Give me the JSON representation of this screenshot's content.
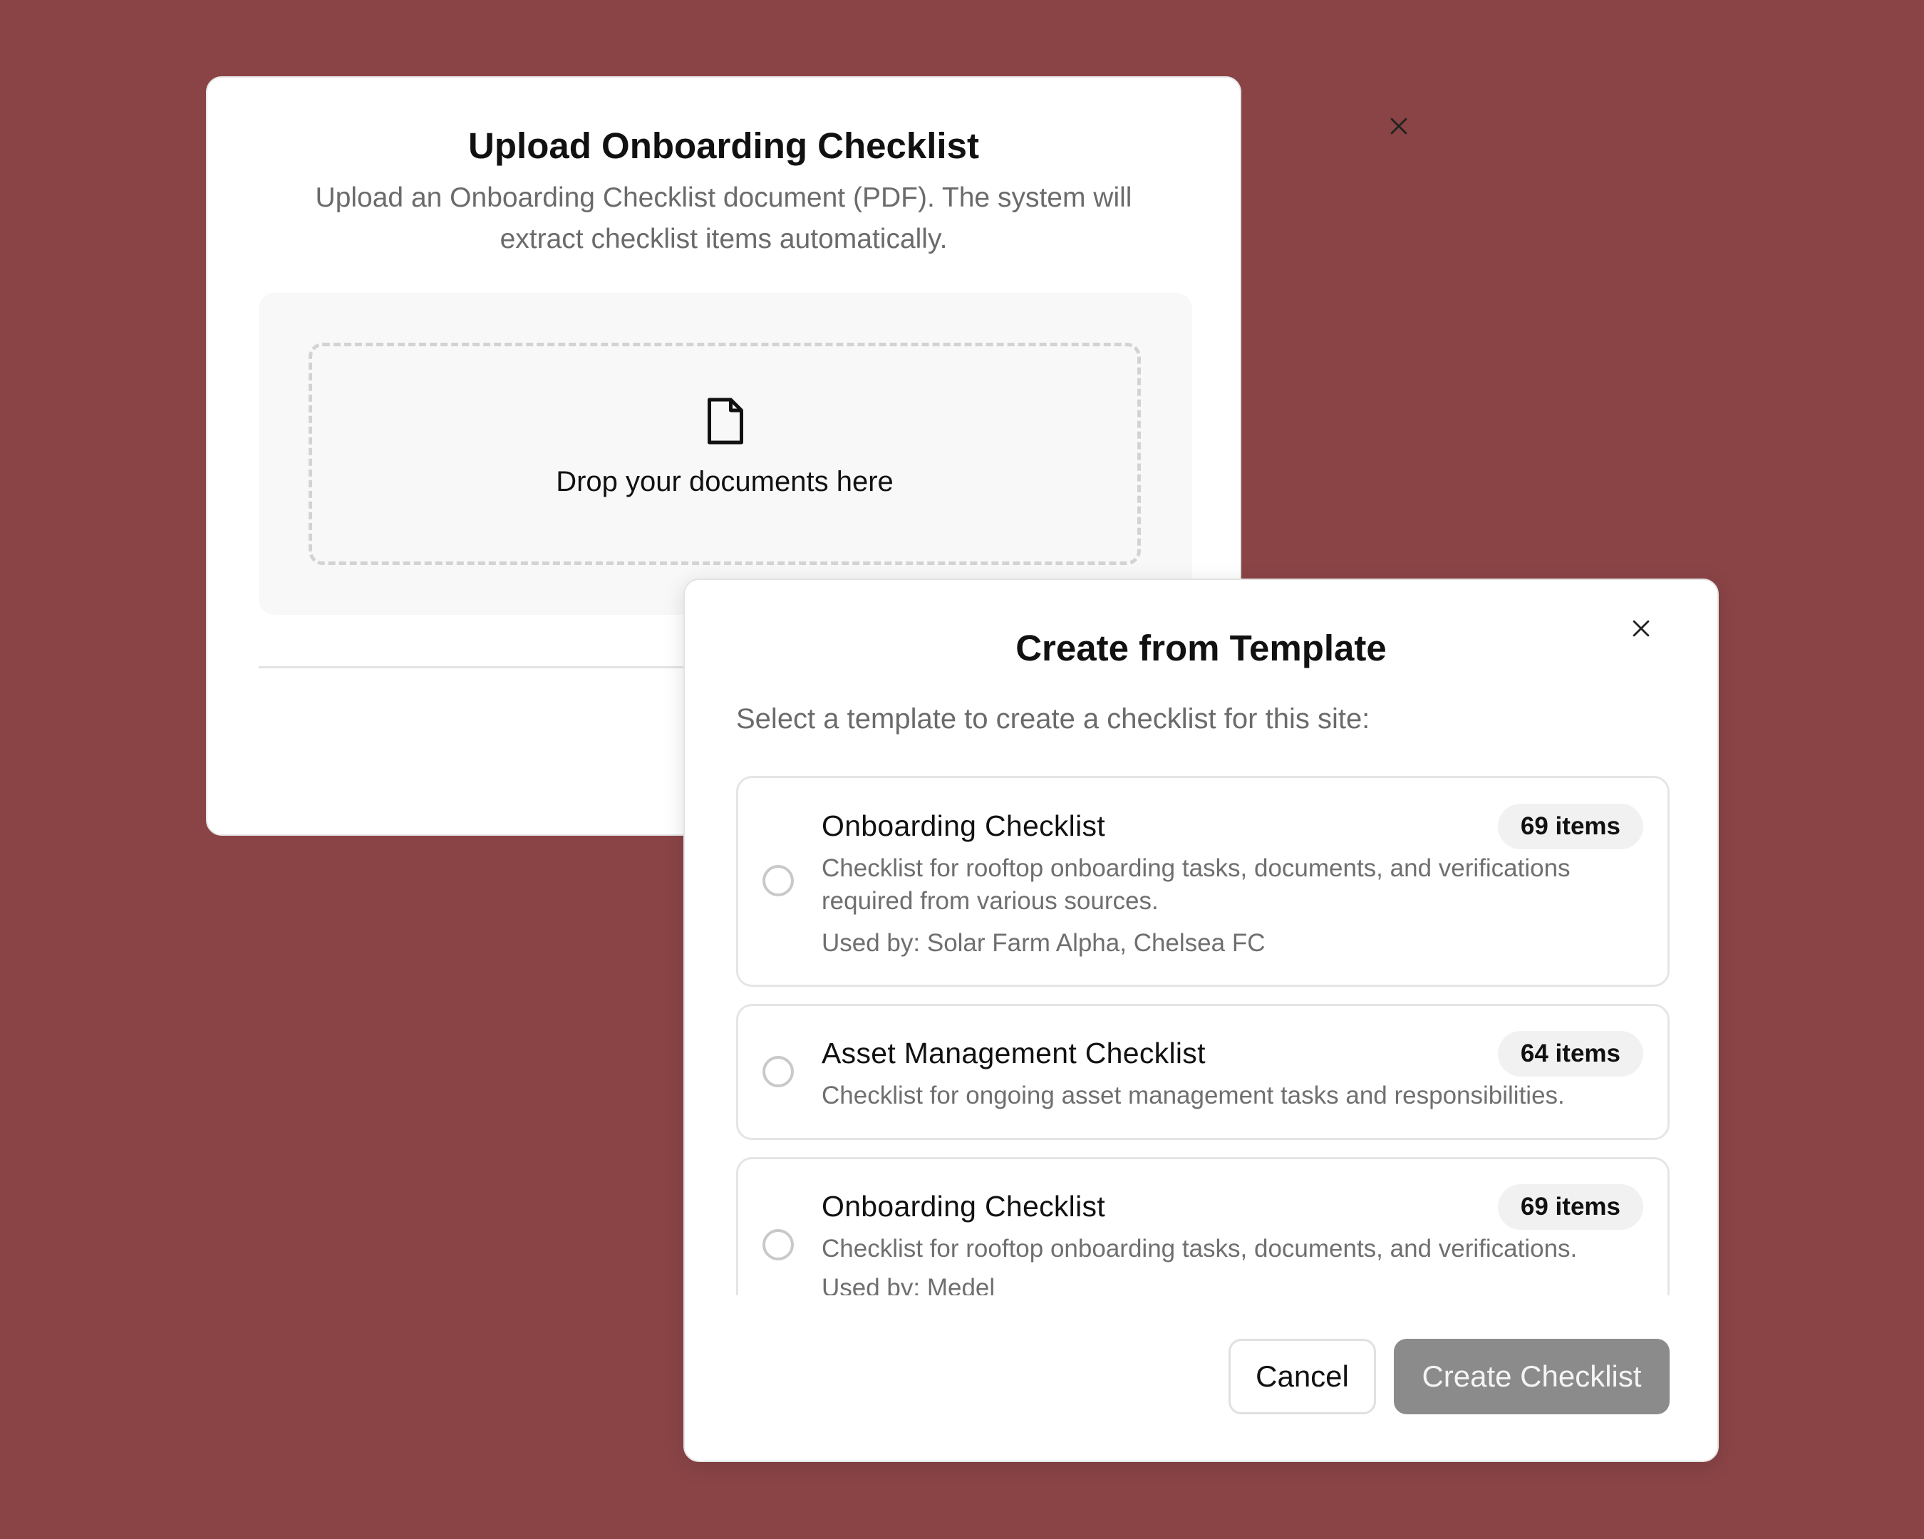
{
  "upload_modal": {
    "title": "Upload Onboarding Checklist",
    "description": "Upload an Onboarding Checklist document (PDF). The system will extract checklist items automatically.",
    "drop_text": "Drop your documents here",
    "icons": {
      "close": "close-icon",
      "document": "document-icon"
    }
  },
  "template_modal": {
    "title": "Create from Template",
    "subtitle": "Select a template to create a checklist for this site:",
    "templates": [
      {
        "name": "Onboarding Checklist",
        "badge": "69 items",
        "description": "Checklist for rooftop onboarding tasks, documents, and verifications required from various sources.",
        "used_by": "Used by: Solar Farm Alpha, Chelsea FC",
        "selected": false
      },
      {
        "name": "Asset Management Checklist",
        "badge": "64 items",
        "description": "Checklist for ongoing asset management tasks and responsibilities.",
        "selected": false
      },
      {
        "name": "Onboarding Checklist",
        "badge": "69 items",
        "description": "Checklist for rooftop onboarding tasks, documents, and verifications.",
        "used_by": "Used by: Medel",
        "selected": false
      }
    ],
    "buttons": {
      "cancel": "Cancel",
      "create": "Create Checklist"
    }
  },
  "colors": {
    "background": "#8a4446",
    "disabled_button": "#8b8b8b"
  }
}
